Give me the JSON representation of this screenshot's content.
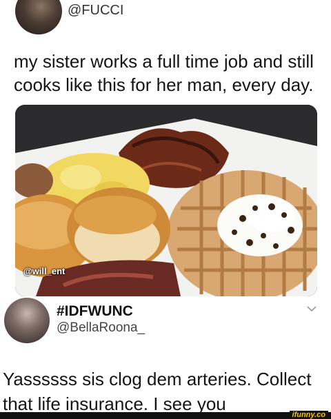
{
  "post": {
    "handle": "@FUCCI",
    "text": "my sister works a full time job and still cooks like this for her man, every day.",
    "photo_watermark": "@will_ent"
  },
  "quote": {
    "display_name": "#IDFWUNC",
    "handle": "@BellaRoona_",
    "text": "Yassssss sis clog dem arteries. Collect that life insurance. I see you"
  },
  "footer": {
    "brand": "ifunny.co"
  },
  "colors": {
    "background": "#ffffff",
    "text": "#151515",
    "brand": "#f5c400"
  },
  "icons": [
    "chevron-down-icon"
  ]
}
